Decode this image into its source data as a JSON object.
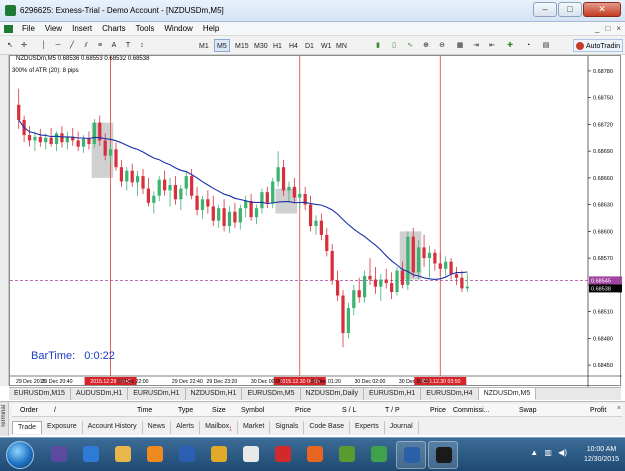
{
  "window": {
    "title": "6296625: Exness-Trial - Demo Account - [NZDUSDm,M5]",
    "buttons": {
      "minimize": "–",
      "maximize": "□",
      "close": "✕"
    }
  },
  "menu": {
    "items": [
      "File",
      "View",
      "Insert",
      "Charts",
      "Tools",
      "Window",
      "Help"
    ],
    "mdi_controls": [
      "_",
      "□",
      "×"
    ]
  },
  "toolbar": {
    "timeframes": [
      "M1",
      "M5",
      "M15",
      "M30",
      "H1",
      "H4",
      "D1",
      "W1",
      "MN"
    ],
    "active_timeframe": "M5",
    "autotrading_label": "AutoTradin"
  },
  "chart": {
    "symbol_line": "NZDUSDm,M5  0.68536 0.68553 0.68532 0.68538",
    "indicator_line": "300% of ATR (20):  8 pips",
    "bartime_label": "BarTime:",
    "bartime_value": "0:0:22",
    "current_price_label": "0.68545",
    "bid_label": "0.68538"
  },
  "chart_data": {
    "type": "candlestick",
    "price_axis_ticks": [
      "0.68780",
      "0.68750",
      "0.68720",
      "0.68690",
      "0.68660",
      "0.68630",
      "0.68600",
      "0.68570",
      "0.68540",
      "0.68510",
      "0.68480",
      "0.68450"
    ],
    "time_axis_labels": [
      "29 Dec 2015",
      "29 Dec 20:40",
      "2015.12.29 21:40",
      "29 Dec 22:00",
      "29 Dec 22:40",
      "29 Dec 23:20",
      "30 Dec 00:00",
      "2015.12.30 00:55",
      "30 Dec 01:20",
      "30 Dec 02:00",
      "30 Dec 02:40",
      "2015.12.30 03:50"
    ],
    "vertical_markers": [
      "2015.12.29 21:40",
      "2015.12.30 00:55",
      "2015.12.30 03:50"
    ],
    "horizontal_line_price": 0.68545,
    "colors": {
      "bull": "#3cb371",
      "bear": "#d6303c",
      "moving_average": "#1b2fa6",
      "vertical_lines": "#e03c3c",
      "horizontal_line": "#a044a0",
      "grid": "#ffffff",
      "box_fill": "#c8c8c8"
    },
    "candles": [
      {
        "o": 0.68742,
        "h": 0.6876,
        "l": 0.68715,
        "c": 0.68725
      },
      {
        "o": 0.68725,
        "h": 0.6873,
        "l": 0.687,
        "c": 0.68708
      },
      {
        "o": 0.68708,
        "h": 0.68718,
        "l": 0.68695,
        "c": 0.68702
      },
      {
        "o": 0.68702,
        "h": 0.68712,
        "l": 0.6869,
        "c": 0.68706
      },
      {
        "o": 0.68706,
        "h": 0.68715,
        "l": 0.68695,
        "c": 0.687
      },
      {
        "o": 0.687,
        "h": 0.6871,
        "l": 0.68692,
        "c": 0.68705
      },
      {
        "o": 0.68705,
        "h": 0.68716,
        "l": 0.68695,
        "c": 0.68698
      },
      {
        "o": 0.68698,
        "h": 0.68712,
        "l": 0.6869,
        "c": 0.6871
      },
      {
        "o": 0.6871,
        "h": 0.68718,
        "l": 0.68694,
        "c": 0.687
      },
      {
        "o": 0.687,
        "h": 0.68712,
        "l": 0.68692,
        "c": 0.68706
      },
      {
        "o": 0.68706,
        "h": 0.68716,
        "l": 0.68696,
        "c": 0.68702
      },
      {
        "o": 0.68702,
        "h": 0.68712,
        "l": 0.6869,
        "c": 0.68695
      },
      {
        "o": 0.68695,
        "h": 0.68708,
        "l": 0.68688,
        "c": 0.68704
      },
      {
        "o": 0.68704,
        "h": 0.68712,
        "l": 0.68692,
        "c": 0.68698
      },
      {
        "o": 0.68698,
        "h": 0.68726,
        "l": 0.68694,
        "c": 0.68722
      },
      {
        "o": 0.68722,
        "h": 0.6873,
        "l": 0.68696,
        "c": 0.68702
      },
      {
        "o": 0.68702,
        "h": 0.6871,
        "l": 0.6868,
        "c": 0.68685
      },
      {
        "o": 0.68685,
        "h": 0.68698,
        "l": 0.68676,
        "c": 0.68692
      },
      {
        "o": 0.68692,
        "h": 0.687,
        "l": 0.68668,
        "c": 0.68672
      },
      {
        "o": 0.68672,
        "h": 0.6868,
        "l": 0.6865,
        "c": 0.68656
      },
      {
        "o": 0.68656,
        "h": 0.68672,
        "l": 0.68646,
        "c": 0.68668
      },
      {
        "o": 0.68668,
        "h": 0.68676,
        "l": 0.6865,
        "c": 0.68655
      },
      {
        "o": 0.68655,
        "h": 0.68668,
        "l": 0.6864,
        "c": 0.68662
      },
      {
        "o": 0.68662,
        "h": 0.6867,
        "l": 0.68642,
        "c": 0.68648
      },
      {
        "o": 0.68648,
        "h": 0.6866,
        "l": 0.68628,
        "c": 0.68632
      },
      {
        "o": 0.68632,
        "h": 0.68645,
        "l": 0.6862,
        "c": 0.6864
      },
      {
        "o": 0.6864,
        "h": 0.68662,
        "l": 0.68634,
        "c": 0.68658
      },
      {
        "o": 0.68658,
        "h": 0.68668,
        "l": 0.6864,
        "c": 0.68646
      },
      {
        "o": 0.68646,
        "h": 0.6866,
        "l": 0.68628,
        "c": 0.68652
      },
      {
        "o": 0.68652,
        "h": 0.68662,
        "l": 0.6863,
        "c": 0.68636
      },
      {
        "o": 0.68636,
        "h": 0.68652,
        "l": 0.68624,
        "c": 0.68648
      },
      {
        "o": 0.68648,
        "h": 0.68668,
        "l": 0.6864,
        "c": 0.68662
      },
      {
        "o": 0.68662,
        "h": 0.6867,
        "l": 0.68636,
        "c": 0.6864
      },
      {
        "o": 0.6864,
        "h": 0.6865,
        "l": 0.68618,
        "c": 0.68624
      },
      {
        "o": 0.68624,
        "h": 0.6864,
        "l": 0.68614,
        "c": 0.68636
      },
      {
        "o": 0.68636,
        "h": 0.68646,
        "l": 0.6862,
        "c": 0.68628
      },
      {
        "o": 0.68628,
        "h": 0.6864,
        "l": 0.68606,
        "c": 0.68612
      },
      {
        "o": 0.68612,
        "h": 0.6863,
        "l": 0.68604,
        "c": 0.68626
      },
      {
        "o": 0.68626,
        "h": 0.68636,
        "l": 0.686,
        "c": 0.68606
      },
      {
        "o": 0.68606,
        "h": 0.68628,
        "l": 0.68598,
        "c": 0.68622
      },
      {
        "o": 0.68622,
        "h": 0.68632,
        "l": 0.68604,
        "c": 0.6861
      },
      {
        "o": 0.6861,
        "h": 0.6863,
        "l": 0.68602,
        "c": 0.68626
      },
      {
        "o": 0.68626,
        "h": 0.6864,
        "l": 0.68616,
        "c": 0.68634
      },
      {
        "o": 0.68634,
        "h": 0.68642,
        "l": 0.68612,
        "c": 0.68616
      },
      {
        "o": 0.68616,
        "h": 0.6863,
        "l": 0.68608,
        "c": 0.68626
      },
      {
        "o": 0.68626,
        "h": 0.68648,
        "l": 0.6862,
        "c": 0.68644
      },
      {
        "o": 0.68644,
        "h": 0.6865,
        "l": 0.68626,
        "c": 0.68632
      },
      {
        "o": 0.68632,
        "h": 0.6866,
        "l": 0.68626,
        "c": 0.68656
      },
      {
        "o": 0.68656,
        "h": 0.6869,
        "l": 0.6865,
        "c": 0.68672
      },
      {
        "o": 0.68672,
        "h": 0.6868,
        "l": 0.6864,
        "c": 0.68646
      },
      {
        "o": 0.68646,
        "h": 0.68656,
        "l": 0.68634,
        "c": 0.6865
      },
      {
        "o": 0.6865,
        "h": 0.6866,
        "l": 0.68632,
        "c": 0.68638
      },
      {
        "o": 0.68638,
        "h": 0.68648,
        "l": 0.68626,
        "c": 0.68642
      },
      {
        "o": 0.68642,
        "h": 0.6865,
        "l": 0.68624,
        "c": 0.6863
      },
      {
        "o": 0.6863,
        "h": 0.6864,
        "l": 0.686,
        "c": 0.68606
      },
      {
        "o": 0.68606,
        "h": 0.68618,
        "l": 0.68596,
        "c": 0.68612
      },
      {
        "o": 0.68612,
        "h": 0.6862,
        "l": 0.6859,
        "c": 0.68596
      },
      {
        "o": 0.68596,
        "h": 0.68604,
        "l": 0.68572,
        "c": 0.68578
      },
      {
        "o": 0.68578,
        "h": 0.68586,
        "l": 0.6854,
        "c": 0.68545
      },
      {
        "o": 0.68545,
        "h": 0.68556,
        "l": 0.68522,
        "c": 0.68528
      },
      {
        "o": 0.68528,
        "h": 0.68534,
        "l": 0.6847,
        "c": 0.68486
      },
      {
        "o": 0.68486,
        "h": 0.6852,
        "l": 0.6848,
        "c": 0.68514
      },
      {
        "o": 0.68514,
        "h": 0.6854,
        "l": 0.68506,
        "c": 0.68534
      },
      {
        "o": 0.68534,
        "h": 0.68548,
        "l": 0.6852,
        "c": 0.68526
      },
      {
        "o": 0.68526,
        "h": 0.68556,
        "l": 0.6852,
        "c": 0.6855
      },
      {
        "o": 0.6855,
        "h": 0.6857,
        "l": 0.6854,
        "c": 0.68546
      },
      {
        "o": 0.68546,
        "h": 0.6856,
        "l": 0.6853,
        "c": 0.68538
      },
      {
        "o": 0.68538,
        "h": 0.68552,
        "l": 0.68522,
        "c": 0.68546
      },
      {
        "o": 0.68546,
        "h": 0.68558,
        "l": 0.68536,
        "c": 0.68542
      },
      {
        "o": 0.68542,
        "h": 0.68554,
        "l": 0.68524,
        "c": 0.68532
      },
      {
        "o": 0.68532,
        "h": 0.6856,
        "l": 0.68528,
        "c": 0.68556
      },
      {
        "o": 0.68556,
        "h": 0.68566,
        "l": 0.68536,
        "c": 0.6854
      },
      {
        "o": 0.6854,
        "h": 0.686,
        "l": 0.68534,
        "c": 0.68594
      },
      {
        "o": 0.68594,
        "h": 0.68604,
        "l": 0.68548,
        "c": 0.68554
      },
      {
        "o": 0.68554,
        "h": 0.6859,
        "l": 0.68546,
        "c": 0.68582
      },
      {
        "o": 0.68582,
        "h": 0.68596,
        "l": 0.6856,
        "c": 0.6857
      },
      {
        "o": 0.6857,
        "h": 0.68584,
        "l": 0.68548,
        "c": 0.68576
      },
      {
        "o": 0.68576,
        "h": 0.6858,
        "l": 0.68556,
        "c": 0.68564
      },
      {
        "o": 0.68564,
        "h": 0.68576,
        "l": 0.6855,
        "c": 0.68558
      },
      {
        "o": 0.68558,
        "h": 0.68572,
        "l": 0.68548,
        "c": 0.68566
      },
      {
        "o": 0.68566,
        "h": 0.6857,
        "l": 0.68546,
        "c": 0.68552
      },
      {
        "o": 0.68552,
        "h": 0.6856,
        "l": 0.6854,
        "c": 0.68548
      },
      {
        "o": 0.68548,
        "h": 0.68556,
        "l": 0.68532,
        "c": 0.68536
      },
      {
        "o": 0.68536,
        "h": 0.68553,
        "l": 0.68532,
        "c": 0.68538
      }
    ],
    "boxes": [
      {
        "from": 14,
        "to": 17,
        "hi": 0.68722,
        "lo": 0.6866
      },
      {
        "from": 48,
        "to": 51,
        "hi": 0.68648,
        "lo": 0.6862
      },
      {
        "from": 71,
        "to": 74,
        "hi": 0.686,
        "lo": 0.68546
      }
    ],
    "markers_at_index": [
      17,
      52,
      78
    ],
    "y_range": [
      0.6844,
      0.6879
    ]
  },
  "chart_tabs": [
    "EURUSDm,M15",
    "AUDUSDm,H1",
    "EURUSDm,H1",
    "NZDUSDm,H1",
    "EURUSDm,M5",
    "NZDUSDm,Daily",
    "EURUSDm,H1",
    "EURUSDm,H4",
    "NZDUSDm,M5"
  ],
  "active_chart_tab": "NZDUSDm,M5",
  "terminal": {
    "side_label": "Terminal",
    "columns": [
      "Order",
      "/",
      "Time",
      "Type",
      "Size",
      "Symbol",
      "Price",
      "S / L",
      "T / P",
      "Price",
      "Commissi...",
      "Swap",
      "Profit"
    ],
    "tabs": [
      "Trade",
      "Exposure",
      "Account History",
      "News",
      "Alerts",
      "Mailbox",
      "Market",
      "Signals",
      "Code Base",
      "Experts",
      "Journal"
    ],
    "mailbox_badge": "1",
    "active_tab": "Trade",
    "close": "×"
  },
  "taskbar": {
    "time": "10:00 AM",
    "date": "12/30/2015",
    "apps": [
      {
        "name": "winamp-icon",
        "color": "#5a4ba0"
      },
      {
        "name": "ie-icon",
        "color": "#2d7bd6"
      },
      {
        "name": "explorer-icon",
        "color": "#e8b64a"
      },
      {
        "name": "media-player-icon",
        "color": "#f08a1f"
      },
      {
        "name": "word-icon",
        "color": "#2c5fb3"
      },
      {
        "name": "charts-icon",
        "color": "#e0a92a"
      },
      {
        "name": "panda-icon",
        "color": "#e8e8e8"
      },
      {
        "name": "opera-icon",
        "color": "#d22a2a"
      },
      {
        "name": "firefox-icon",
        "color": "#e8661f"
      },
      {
        "name": "utorrent-icon",
        "color": "#5a9a2f"
      },
      {
        "name": "chrome-icon",
        "color": "#3fa24a"
      },
      {
        "name": "metatrader-icon",
        "color": "#2b5fa8"
      },
      {
        "name": "zulutrade-icon",
        "color": "#1a1a1a"
      }
    ]
  }
}
